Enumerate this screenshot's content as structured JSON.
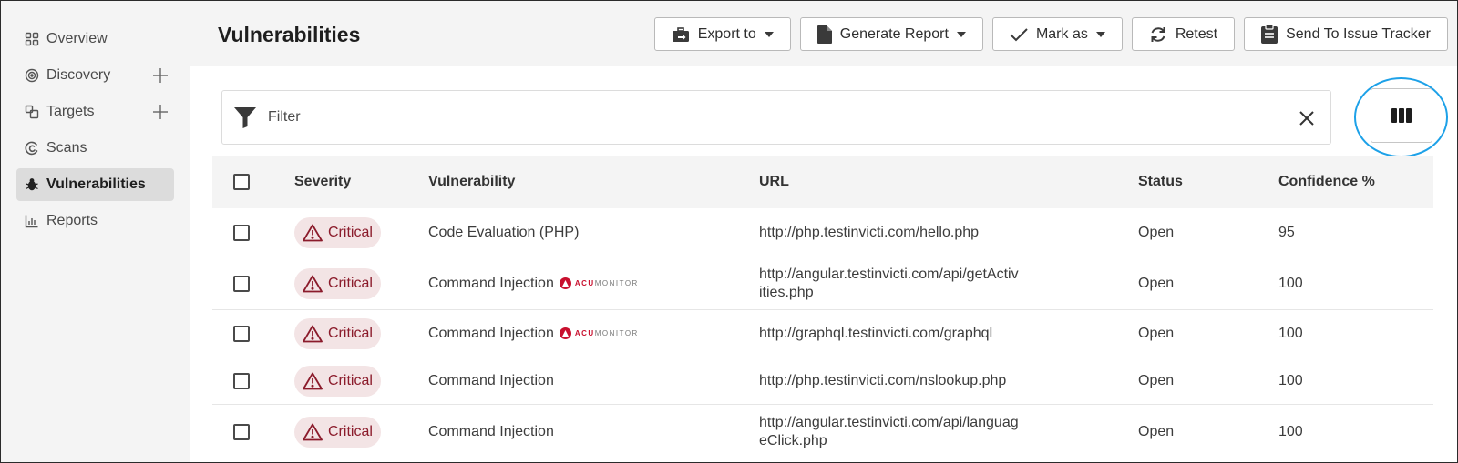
{
  "sidebar": {
    "items": [
      {
        "label": "Overview",
        "icon": "grid-icon"
      },
      {
        "label": "Discovery",
        "icon": "target-circle-icon"
      },
      {
        "label": "Targets",
        "icon": "targets-icon"
      },
      {
        "label": "Scans",
        "icon": "scan-icon"
      },
      {
        "label": "Vulnerabilities",
        "icon": "bug-icon",
        "active": true
      },
      {
        "label": "Reports",
        "icon": "bar-chart-icon"
      }
    ]
  },
  "header": {
    "title": "Vulnerabilities",
    "buttons": {
      "export": "Export to",
      "generate": "Generate Report",
      "mark": "Mark as",
      "retest": "Retest",
      "send": "Send To Issue Tracker"
    }
  },
  "filter": {
    "placeholder": "Filter"
  },
  "table": {
    "columns": {
      "severity": "Severity",
      "vulnerability": "Vulnerability",
      "url": "URL",
      "status": "Status",
      "confidence": "Confidence %"
    },
    "rows": [
      {
        "severity": "Critical",
        "vulnerability": "Code Evaluation (PHP)",
        "acumonitor": false,
        "url_line1": "http://php.testinvicti.com/hello.php",
        "url_line2": "",
        "status": "Open",
        "confidence": "95"
      },
      {
        "severity": "Critical",
        "vulnerability": "Command Injection",
        "acumonitor": true,
        "url_line1": "http://angular.testinvicti.com/api/getActiv",
        "url_line2": "ities.php",
        "status": "Open",
        "confidence": "100"
      },
      {
        "severity": "Critical",
        "vulnerability": "Command Injection",
        "acumonitor": true,
        "url_line1": "http://graphql.testinvicti.com/graphql",
        "url_line2": "",
        "status": "Open",
        "confidence": "100"
      },
      {
        "severity": "Critical",
        "vulnerability": "Command Injection",
        "acumonitor": false,
        "url_line1": "http://php.testinvicti.com/nslookup.php",
        "url_line2": "",
        "status": "Open",
        "confidence": "100"
      },
      {
        "severity": "Critical",
        "vulnerability": "Command Injection",
        "acumonitor": false,
        "url_line1": "http://angular.testinvicti.com/api/languag",
        "url_line2": "eClick.php",
        "status": "Open",
        "confidence": "100"
      }
    ]
  },
  "acumonitor": {
    "prefix": "ACU",
    "suffix": "MONITOR"
  },
  "colors": {
    "critical_bg": "#f3e4e5",
    "critical_text": "#8b1b2b",
    "highlight_ring": "#1da1e8"
  }
}
